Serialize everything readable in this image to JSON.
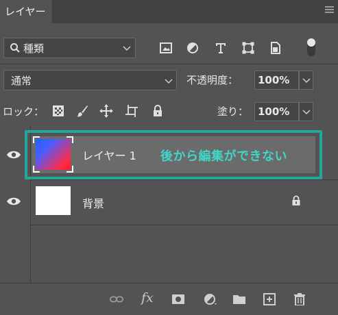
{
  "panel": {
    "tab_label": "レイヤー"
  },
  "filter": {
    "label": "種類"
  },
  "blend": {
    "mode": "通常",
    "opacity_label": "不透明度：",
    "opacity_value": "100%",
    "fill_label": "塗り：",
    "fill_value": "100%"
  },
  "lock": {
    "label": "ロック："
  },
  "layers": [
    {
      "name": "レイヤー 1",
      "selected": true,
      "thumbnail": "red-blue-gradient"
    },
    {
      "name": "背景",
      "selected": false,
      "thumbnail": "white",
      "locked": true
    }
  ],
  "annotation": {
    "text": "後から編集ができない",
    "color": "#22a89a"
  },
  "bottom_toolbar": {
    "fx_label": "fx",
    "icons": [
      "link-icon",
      "fx-icon",
      "mask-icon",
      "adjustment-icon",
      "folder-icon",
      "new-layer-icon",
      "trash-icon"
    ]
  },
  "colors": {
    "panel_bg": "#535353",
    "selected_row": "#6b6b6b",
    "accent": "#22a89a"
  }
}
